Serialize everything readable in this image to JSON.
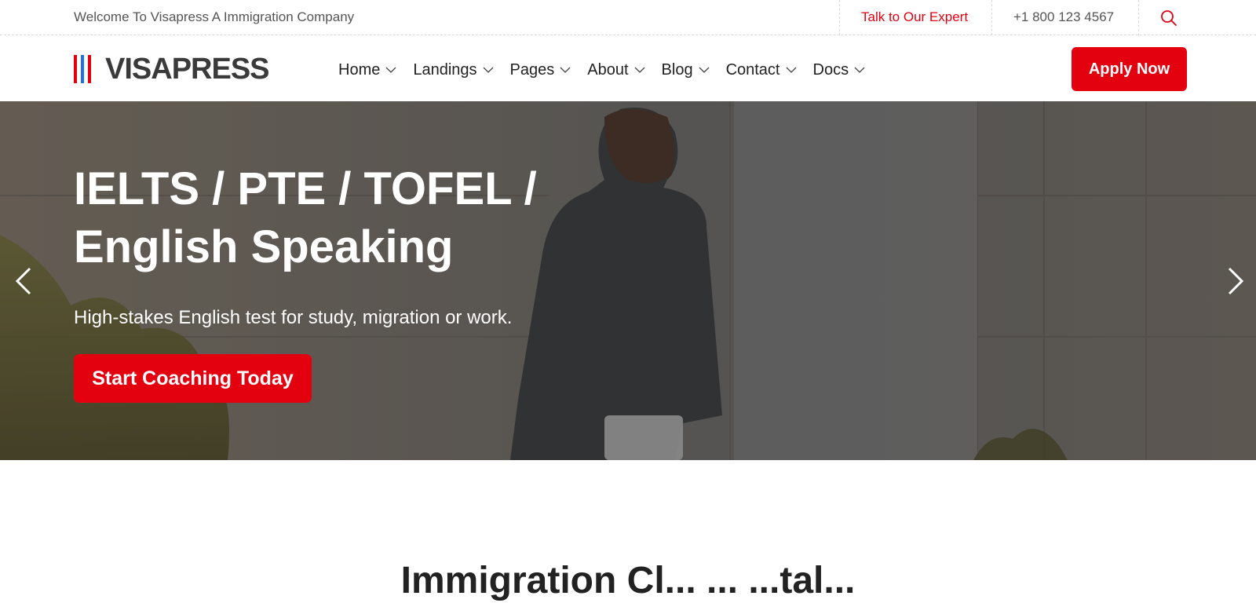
{
  "topbar": {
    "welcome": "Welcome To Visapress A Immigration Company",
    "expert_link": "Talk to Our Expert",
    "phone": "+1 800 123 4567",
    "search_icon": "search-icon"
  },
  "brand": {
    "name": "VISAPRESS",
    "bar_colors": [
      "#e3000f",
      "#1e73e8",
      "#e3000f"
    ]
  },
  "nav": {
    "items": [
      {
        "label": "Home"
      },
      {
        "label": "Landings"
      },
      {
        "label": "Pages"
      },
      {
        "label": "About"
      },
      {
        "label": "Blog"
      },
      {
        "label": "Contact"
      },
      {
        "label": "Docs"
      }
    ],
    "cta": "Apply Now"
  },
  "hero": {
    "title_line1": "IELTS / PTE / TOFEL /",
    "title_line2": "English Speaking",
    "subtitle": "High-stakes English test for study, migration or work.",
    "button": "Start Coaching Today",
    "prev_icon": "chevron-left-icon",
    "next_icon": "chevron-right-icon"
  },
  "section": {
    "heading": "Immigration Cl... ... ...tal..."
  },
  "colors": {
    "accent": "#e3000f",
    "text_dark": "#222222",
    "text_muted": "#555555"
  }
}
